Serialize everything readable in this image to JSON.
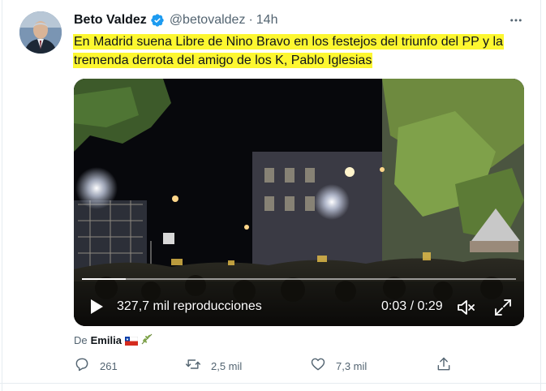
{
  "tweet": {
    "author_name": "Beto Valdez",
    "handle": "@betovaldez",
    "separator": "·",
    "time": "14h",
    "text_line1": "En Madrid suena Libre  de Nino Bravo en los festejos del triunfo del PP y la",
    "text_line2": "tremenda derrota del amigo de los K, Pablo Iglesias",
    "highlight_color": "#fdf730"
  },
  "video": {
    "views": "327,7 mil reproducciones",
    "duration": "0:03 / 0:29",
    "progress": 0.1
  },
  "context": {
    "prefix": "De",
    "name": "Emilia"
  },
  "actions": {
    "replies": "261",
    "retweets": "2,5 mil",
    "likes": "7,3 mil"
  },
  "icons": [
    "verified-icon",
    "more-icon",
    "play-icon",
    "mute-icon",
    "fullscreen-icon",
    "chile-flag-icon",
    "olive-branch-icon",
    "reply-icon",
    "retweet-icon",
    "like-icon",
    "share-icon"
  ],
  "colors": {
    "verified": "#1d9bf0",
    "secondary_text": "#536471",
    "text": "#0f1419"
  }
}
